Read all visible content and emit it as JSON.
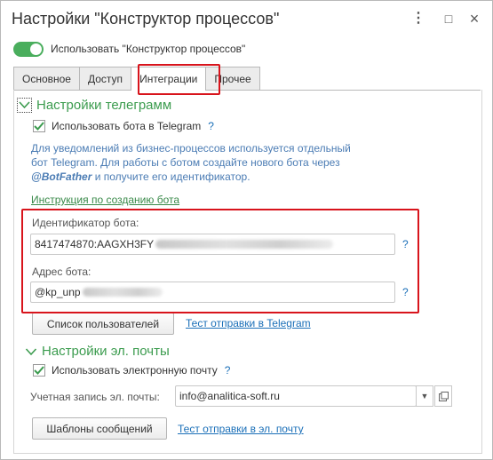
{
  "window": {
    "title": "Настройки \"Конструктор процессов\"",
    "more_glyph": "⋮",
    "maximize_glyph": "□",
    "close_glyph": "×"
  },
  "main_toggle": {
    "label": "Использовать \"Конструктор процессов\"",
    "checked": true
  },
  "tabs": [
    {
      "label": "Основное",
      "active": false
    },
    {
      "label": "Доступ",
      "active": false
    },
    {
      "label": "Интеграции",
      "active": true
    },
    {
      "label": "Прочее",
      "active": false
    }
  ],
  "telegram": {
    "header": "Настройки телеграмм",
    "use_bot_label": "Использовать бота в Telegram",
    "use_bot_checked": true,
    "help": "?",
    "info_line1": "Для уведомлений из бизнес-процессов используется отдельный",
    "info_line2": "бот Telegram. Для работы с ботом создайте нового бота через",
    "info_botfather": "@BotFather",
    "info_line3_rest": " и получите его идентификатор.",
    "instruction_link": "Инструкция по созданию бота",
    "bot_id_label": "Идентификатор бота:",
    "bot_id_value": "8417474870:AAGXH3FY",
    "bot_address_label": "Адрес бота:",
    "bot_address_value": "@kp_unp",
    "users_button": "Список пользователей",
    "test_link": "Тест отправки в Telegram"
  },
  "email": {
    "header": "Настройки эл. почты",
    "use_email_label": "Использовать электронную почту",
    "use_email_checked": true,
    "help": "?",
    "account_label": "Учетная запись эл. почты:",
    "account_value": "info@analitica-soft.ru",
    "templates_button": "Шаблоны сообщений",
    "test_link": "Тест отправки в эл. почту"
  },
  "colors": {
    "accent_green": "#3c9c4f",
    "link_blue": "#1a6fb8",
    "highlight_red": "#d8141c",
    "toggle_green": "#4aae5d"
  }
}
